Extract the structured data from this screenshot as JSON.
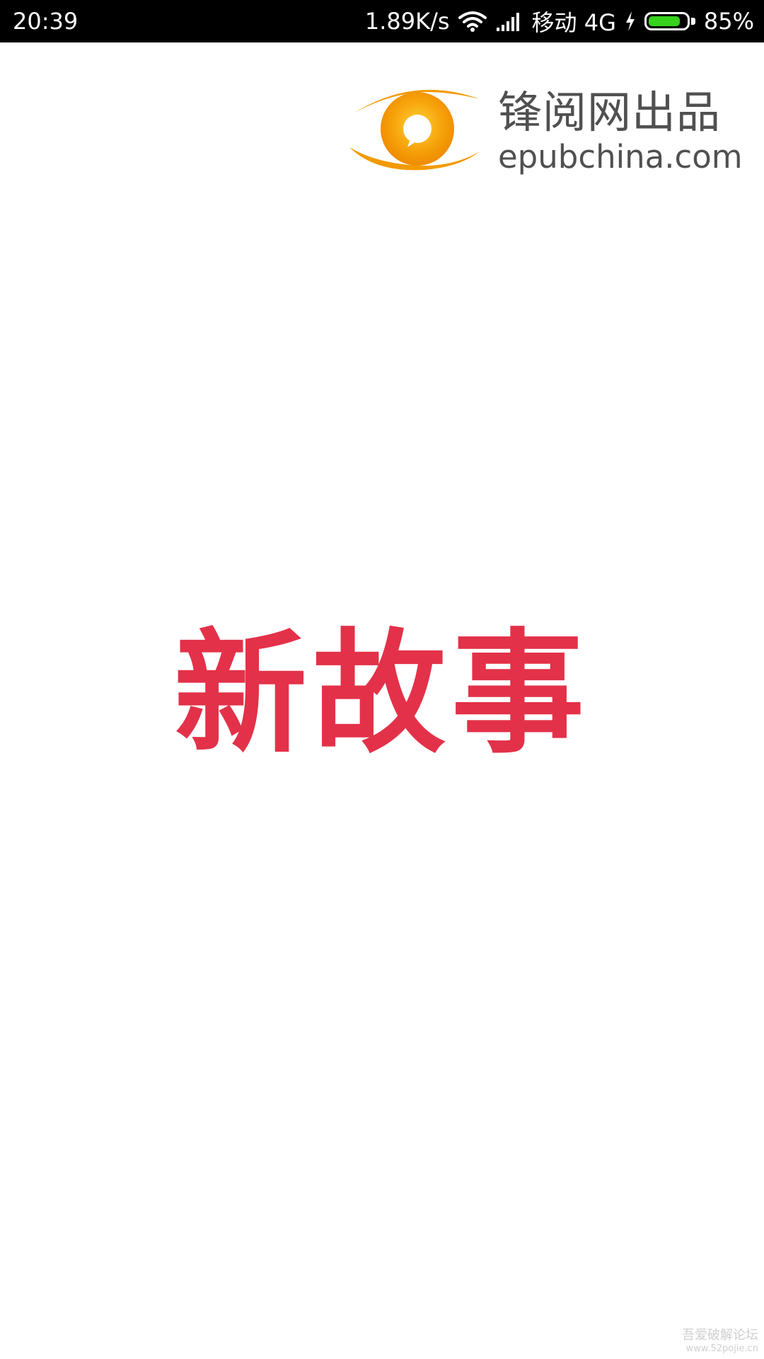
{
  "status_bar": {
    "time": "20:39",
    "net_speed": "1.89K/s",
    "carrier": "移动 4G",
    "battery": "85%",
    "battery_level": 0.85,
    "battery_color": "#37d21c",
    "icons": [
      "wifi-icon",
      "signal-icon",
      "charging-icon",
      "battery-icon"
    ]
  },
  "publisher": {
    "name": "锋阅网出品",
    "url": "epubchina.com",
    "logo_icon": "eye-logo-icon",
    "colors": {
      "ring": "#f39a00",
      "text": "#505050"
    }
  },
  "app": {
    "title": "新故事",
    "title_color": "#e33149"
  },
  "watermark": {
    "line1": "吾爱破解论坛",
    "line2": "www.52pojie.cn"
  }
}
